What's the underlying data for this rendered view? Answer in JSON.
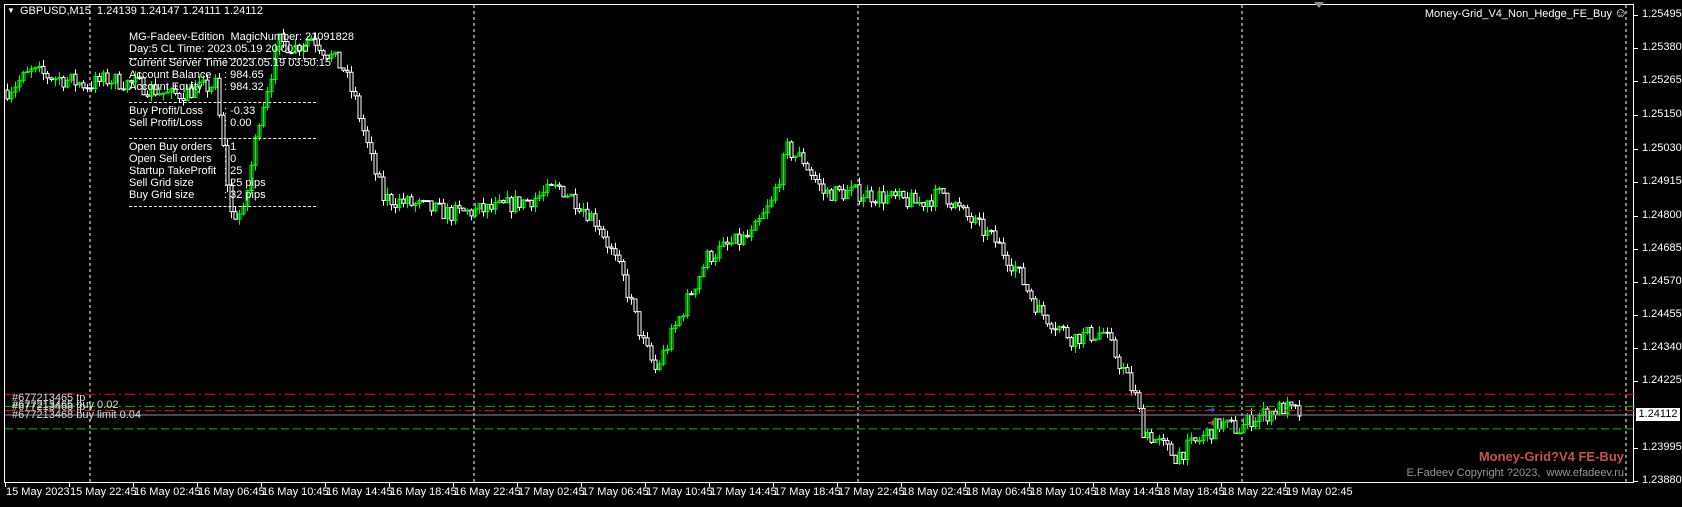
{
  "header": {
    "symbol": "GBPUSD,M15",
    "ohlc": "1.24139 1.24147 1.24111 1.24112"
  },
  "expert": {
    "name": "Money-Grid_V4_Non_Hedge_FE_Buy",
    "status_icon": "smiley-icon"
  },
  "info_panel": {
    "line1": "MG-Fadeev-Edition  MagicNumber: 21091828",
    "line2": "Day:5 CL Time: 2023.05.19 20:00:00",
    "rows": [
      {
        "label": "Current Server Time",
        "value": ": 2023.05.19 03:50:15"
      },
      {
        "label": "Account Balance",
        "value": ": 984.65"
      },
      {
        "label": "Account Equity",
        "value": ": 984.32"
      },
      {
        "label": "Buy Profit/Loss",
        "value": ": -0.33"
      },
      {
        "label": "Sell Profit/Loss",
        "value": ": 0.00"
      },
      {
        "label": "Open Buy orders",
        "value": ": 1"
      },
      {
        "label": "Open Sell orders",
        "value": ": 0"
      },
      {
        "label": "Startup TakeProfit",
        "value": ": 25"
      },
      {
        "label": "Sell Grid size",
        "value": ": 25 pips"
      },
      {
        "label": "Buy Grid size",
        "value": ": 32 pips"
      }
    ]
  },
  "order_labels": [
    "#677213465 tp",
    "#677213465 buy 0.02",
    "#677213468 tp",
    "#677213468 buy limit 0.04"
  ],
  "watermark": {
    "title": "Money-Grid?V4 FE-Buy",
    "copyright": "E.Fadeev Copyright ?2023,  www.efadeev.ru"
  },
  "colors": {
    "bull": "#00ff00",
    "bear": "#ffffff",
    "background": "#000000",
    "tp_line": "#ff0000",
    "order_line": "#00c000",
    "watermark": "#c8504f"
  },
  "chart_data": {
    "type": "candlestick",
    "timeframe": "M15",
    "current_price": "1.24112",
    "price_ticks": [
      "1.25495",
      "1.25380",
      "1.25265",
      "1.25150",
      "1.25030",
      "1.24915",
      "1.24800",
      "1.24685",
      "1.24570",
      "1.24455",
      "1.24340",
      "1.24225",
      "1.23995",
      "1.23880"
    ],
    "ylim": [
      1.2388,
      1.25495
    ],
    "time_ticks": [
      "15 May 2023",
      "15 May 22:45",
      "16 May 02:45",
      "16 May 06:45",
      "16 May 10:45",
      "16 May 14:45",
      "16 May 18:45",
      "16 May 22:45",
      "17 May 02:45",
      "17 May 06:45",
      "17 May 10:45",
      "17 May 14:45",
      "17 May 18:45",
      "17 May 22:45",
      "18 May 02:45",
      "18 May 06:45",
      "18 May 10:45",
      "18 May 14:45",
      "18 May 18:45",
      "18 May 22:45",
      "19 May 02:45"
    ],
    "period_separators": [
      "16 May",
      "17 May",
      "18 May",
      "19 May"
    ],
    "order_levels": [
      {
        "label": "tp",
        "price": 1.24184,
        "color": "#ff0000",
        "style": "dash-dot"
      },
      {
        "label": "buy 0.02",
        "price": 1.24142,
        "color": "#00c000",
        "style": "dash-dot"
      },
      {
        "label": "tp",
        "price": 1.24128,
        "color": "#ff0000",
        "style": "dash-dot"
      },
      {
        "label": "buy limit 0.04",
        "price": 1.24064,
        "color": "#00c000",
        "style": "dashed"
      }
    ],
    "close_path": [
      [
        "15 18:45",
        1.25238
      ],
      [
        "15 20:15",
        1.25301
      ],
      [
        "15 23:45",
        1.25256
      ],
      [
        "16 01:00",
        1.25275
      ],
      [
        "16 03:00",
        1.25256
      ],
      [
        "16 05:00",
        1.25219
      ],
      [
        "16 07:45",
        1.25256
      ],
      [
        "16 08:45",
        1.24809
      ],
      [
        "16 09:30",
        1.24809
      ],
      [
        "16 10:30",
        1.25144
      ],
      [
        "16 11:45",
        1.25405
      ],
      [
        "16 12:45",
        1.25387
      ],
      [
        "16 13:45",
        1.25424
      ],
      [
        "16 15:45",
        1.25312
      ],
      [
        "16 16:30",
        1.252
      ],
      [
        "16 17:30",
        1.24995
      ],
      [
        "16 18:15",
        1.24865
      ],
      [
        "16 19:45",
        1.24846
      ],
      [
        "16 22:30",
        1.24809
      ],
      [
        "17 01:15",
        1.24827
      ],
      [
        "17 03:45",
        1.24865
      ],
      [
        "17 05:15",
        1.24902
      ],
      [
        "17 06:30",
        1.24846
      ],
      [
        "17 07:45",
        1.24771
      ],
      [
        "17 09:15",
        1.24585
      ],
      [
        "17 10:30",
        1.24361
      ],
      [
        "17 11:15",
        1.24268
      ],
      [
        "17 11:45",
        1.24324
      ],
      [
        "17 13:15",
        1.2451
      ],
      [
        "17 14:30",
        1.24659
      ],
      [
        "17 15:45",
        1.24697
      ],
      [
        "17 17:15",
        1.24734
      ],
      [
        "17 18:30",
        1.24846
      ],
      [
        "17 19:30",
        1.25032
      ],
      [
        "17 20:30",
        1.24995
      ],
      [
        "17 21:45",
        1.24883
      ],
      [
        "17 23:45",
        1.24883
      ],
      [
        "18 01:45",
        1.24865
      ],
      [
        "18 03:45",
        1.24846
      ],
      [
        "18 05:15",
        1.24883
      ],
      [
        "18 06:30",
        1.24809
      ],
      [
        "18 08:30",
        1.24715
      ],
      [
        "18 09:45",
        1.24622
      ],
      [
        "18 11:15",
        1.24473
      ],
      [
        "18 13:15",
        1.2438
      ],
      [
        "18 15:15",
        1.24398
      ],
      [
        "18 16:30",
        1.24268
      ],
      [
        "18 17:15",
        1.24175
      ],
      [
        "18 17:45",
        1.24063
      ],
      [
        "18 18:30",
        1.24025
      ],
      [
        "18 19:45",
        1.23969
      ],
      [
        "18 21:15",
        1.24025
      ],
      [
        "18 22:30",
        1.24081
      ],
      [
        "18 23:45",
        1.24063
      ],
      [
        "19 00:30",
        1.241
      ],
      [
        "19 02:30",
        1.24137
      ],
      [
        "19 03:45",
        1.24112
      ]
    ]
  }
}
